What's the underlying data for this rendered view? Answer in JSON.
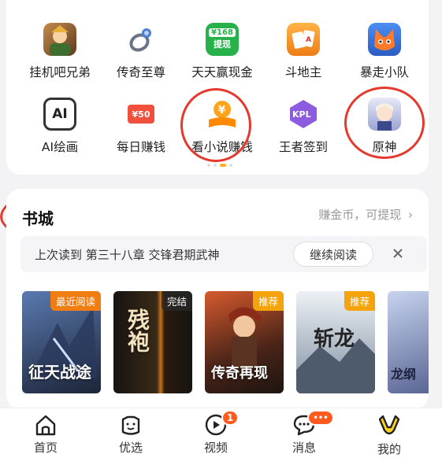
{
  "apps": [
    {
      "label": "挂机吧兄弟",
      "color": "#7b5a3a"
    },
    {
      "label": "传奇至尊",
      "color": "#e9ecf2"
    },
    {
      "label": "天天赢现金",
      "color": "#2fb84f",
      "icon_text": "¥168",
      "icon_text2": "提现"
    },
    {
      "label": "斗地主",
      "color": "#f09a28"
    },
    {
      "label": "暴走小队",
      "color": "#ff6a2a"
    },
    {
      "label": "AI绘画",
      "color": "#333333",
      "icon_text": "AI"
    },
    {
      "label": "每日赚钱",
      "color": "#ef4b3a",
      "icon_text": "¥50"
    },
    {
      "label": "看小说赚钱",
      "color": "#ffa51c",
      "icon_text": "¥"
    },
    {
      "label": "王者签到",
      "color": "#8d5be0",
      "icon_text": "KPL"
    },
    {
      "label": "原神",
      "color": "#d7d9ef"
    }
  ],
  "book_city": {
    "title": "书城",
    "more": "赚金币，可提现",
    "resume_text": "上次读到 第三十八章 交锋君期武神",
    "resume_button": "继续阅读"
  },
  "covers": [
    {
      "tag": "最近阅读",
      "title": "征天战途",
      "bg1": "#3b4e74",
      "bg2": "#1a2233"
    },
    {
      "tag": "完结",
      "title": "残袍",
      "bg1": "#2a2622",
      "bg2": "#5a3b1c"
    },
    {
      "tag": "推荐",
      "title": "传奇再现",
      "bg1": "#b8452a",
      "bg2": "#2c1b14"
    },
    {
      "tag": "推荐",
      "title": "斩龙",
      "bg1": "#dfe6ee",
      "bg2": "#5c6b7c"
    },
    {
      "tag": "",
      "title": "龙纲",
      "bg1": "#b9c8e6",
      "bg2": "#4f5a86"
    }
  ],
  "nav": {
    "items": [
      {
        "label": "首页"
      },
      {
        "label": "优选"
      },
      {
        "label": "视频",
        "badge": "1"
      },
      {
        "label": "消息",
        "badge": "•••"
      },
      {
        "label": "我的"
      }
    ]
  },
  "colors": {
    "accent": "#ffb21a",
    "annotation": "#e4392e"
  }
}
